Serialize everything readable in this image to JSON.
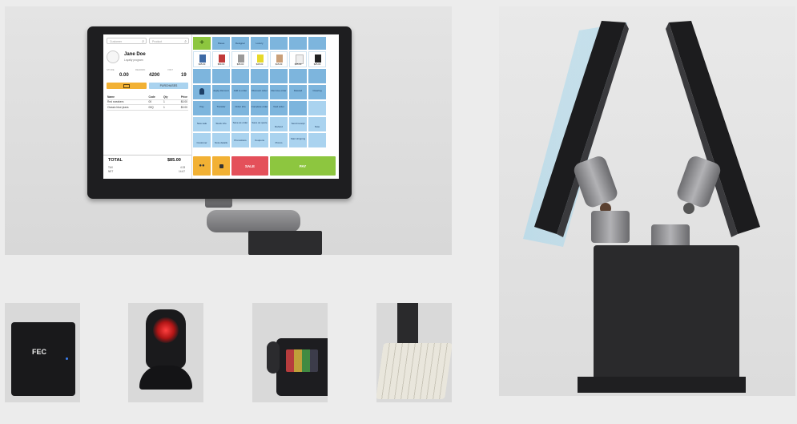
{
  "pos": {
    "customer_placeholder": "Customer",
    "product_placeholder": "Product",
    "customer_name": "Jane Doe",
    "customer_sub": "Loyalty program",
    "stats": [
      {
        "label": "STORE",
        "value": "0.00"
      },
      {
        "label": "REWARD",
        "value": "4200"
      },
      {
        "label": "VISIT",
        "value": "19"
      }
    ],
    "btn_left": "",
    "btn_right": "PURCHASES",
    "order_headers": [
      "Name",
      "Code",
      "Qty",
      "Price"
    ],
    "order_rows": [
      [
        "Red sneakers",
        "00",
        "1",
        "$0.00"
      ],
      [
        "Classic blue jeans",
        "00Q",
        "1",
        "$0.00"
      ]
    ],
    "total_label": "TOTAL",
    "total_value": "$85.00",
    "tax_label": "TAX",
    "tax_value": "4.33",
    "net_label": "NET",
    "net_value": "14.67",
    "sale_label": "SALE",
    "pay_label": "PAY",
    "top_labels": [
      "Shoes",
      "Designer",
      "Luxury"
    ],
    "prices": [
      "$45.00",
      "$59.00",
      "$35.00",
      "$45.00",
      "$15.00",
      "$35.00",
      "$25.00"
    ],
    "tiles_row3": [
      "Apply discount",
      "Add to order",
      "Discount order",
      "Remove order",
      "Deleted",
      "Clearing"
    ],
    "tiles_row4": [
      "Pay",
      "Transfer",
      "Order info",
      "Complete order",
      "Void order"
    ],
    "tiles_row5": [
      "New sale",
      "Stock info",
      "Save as order",
      "Save as quote",
      "Refund",
      "Send receipt",
      "Note"
    ],
    "tiles_row6": [
      "Customer",
      "Note details",
      "Promotions",
      "Coupons",
      "Promo",
      "Start shipping"
    ],
    "colors": {
      "green": "#8dc63f",
      "blue_tile": "#7db5dd",
      "light_tile": "#aad3ef",
      "yellow": "#f2b134",
      "red": "#e4505a",
      "pay_green": "#8dc63f"
    }
  },
  "printer_logo": "FEC"
}
